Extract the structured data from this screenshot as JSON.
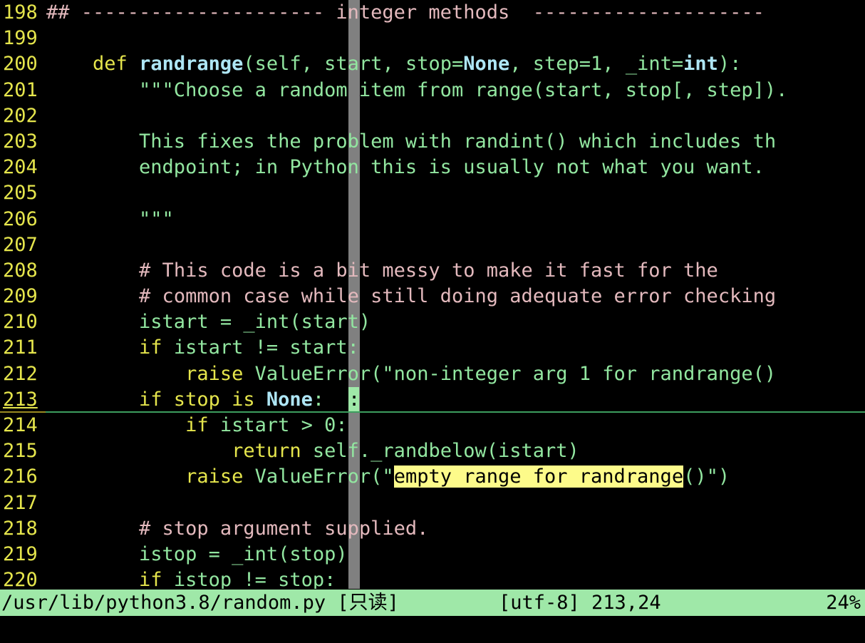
{
  "editor": {
    "colors": {
      "background": "#000000",
      "linenumber": "#e5e54c",
      "comment": "#e3b9bd",
      "keyword": "#e5e54c",
      "function": "#aee6f5",
      "normal": "#92e6a0",
      "search_highlight_bg": "#fdfb8a",
      "search_highlight_fg": "#000000",
      "cursor_bg": "#9fe8a8",
      "colorcolumn": "#808080",
      "statusline_bg": "#9fe8a8",
      "statusline_fg": "#000000",
      "cursorline_rule": "#3d9e5f"
    },
    "cursor": {
      "line": 213,
      "column": 24,
      "char": ":"
    }
  },
  "lines": [
    {
      "number": "198",
      "text": "## --------------------- integer methods  --------------------"
    },
    {
      "number": "199",
      "text": ""
    },
    {
      "number": "200",
      "text": "    def randrange(self, start, stop=None, step=1, _int=int):"
    },
    {
      "number": "201",
      "text": "        \"\"\"Choose a random item from range(start, stop[, step])."
    },
    {
      "number": "202",
      "text": ""
    },
    {
      "number": "203",
      "text": "        This fixes the problem with randint() which includes th"
    },
    {
      "number": "204",
      "text": "        endpoint; in Python this is usually not what you want."
    },
    {
      "number": "205",
      "text": ""
    },
    {
      "number": "206",
      "text": "        \"\"\""
    },
    {
      "number": "207",
      "text": ""
    },
    {
      "number": "208",
      "text": "        # This code is a bit messy to make it fast for the"
    },
    {
      "number": "209",
      "text": "        # common case while still doing adequate error checking"
    },
    {
      "number": "210",
      "text": "        istart = _int(start)"
    },
    {
      "number": "211",
      "text": "        if istart != start:"
    },
    {
      "number": "212",
      "text": "            raise ValueError(\"non-integer arg 1 for randrange()"
    },
    {
      "number": "213",
      "text": "        if stop is None:"
    },
    {
      "number": "214",
      "text": "            if istart > 0:"
    },
    {
      "number": "215",
      "text": "                return self._randbelow(istart)"
    },
    {
      "number": "216",
      "text": "            raise ValueError(\"empty range for randrange()\")"
    },
    {
      "number": "217",
      "text": ""
    },
    {
      "number": "218",
      "text": "        # stop argument supplied."
    },
    {
      "number": "219",
      "text": "        istop = _int(stop)"
    },
    {
      "number": "220",
      "text": "        if istop != stop:"
    }
  ],
  "search": {
    "match_text": "empty range for randrange",
    "line": "216"
  },
  "statusline": {
    "file_path": "/usr/lib/python3.8/random.py",
    "readonly_flag": "[只读]",
    "left": "/usr/lib/python3.8/random.py [只读]",
    "encoding": "[utf-8]",
    "position": "213,24",
    "middle": "[utf-8] 213,24",
    "percent": "24%"
  },
  "cmdline": {
    "text": ""
  }
}
